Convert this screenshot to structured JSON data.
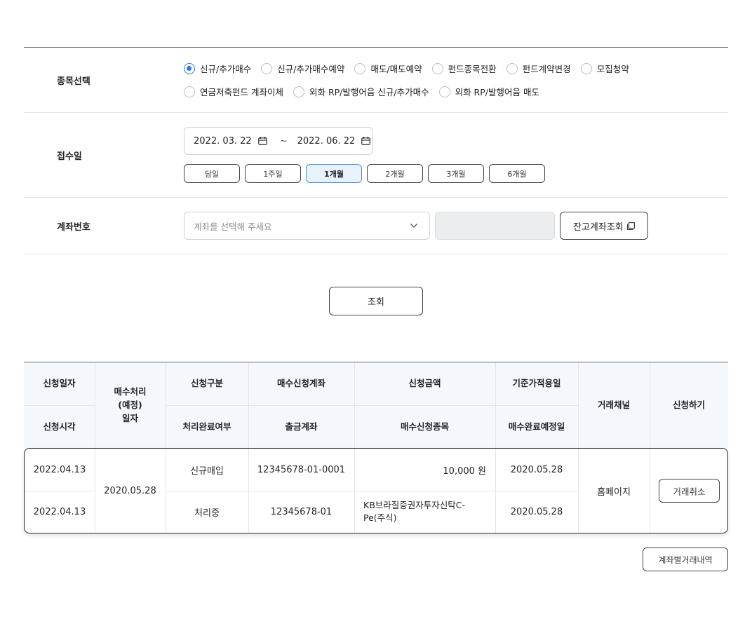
{
  "form": {
    "type_section": {
      "label": "종목선택",
      "options": [
        {
          "label": "신규/추가매수",
          "checked": true
        },
        {
          "label": "신규/추가매수예약",
          "checked": false
        },
        {
          "label": "매도/매도예약",
          "checked": false
        },
        {
          "label": "펀드종목전환",
          "checked": false
        },
        {
          "label": "펀드계약변경",
          "checked": false
        },
        {
          "label": "모집청약",
          "checked": false
        },
        {
          "label": "연금저축펀드 계좌이체",
          "checked": false
        },
        {
          "label": "외화 RP/발행어음 신규/추가매수",
          "checked": false
        },
        {
          "label": "외화 RP/발행어음 매도",
          "checked": false
        }
      ]
    },
    "date_section": {
      "label": "접수일",
      "start_date": "2022. 03. 22",
      "separator": "~",
      "end_date": "2022. 06. 22",
      "periods": [
        "당일",
        "1주일",
        "1개월",
        "2개월",
        "3개월",
        "6개월"
      ],
      "active_period": "1개월"
    },
    "account_section": {
      "label": "계좌번호",
      "select_placeholder": "계좌를 선택해 주세요",
      "balance_button": "잔고계좌조회"
    },
    "search_button": "조회"
  },
  "table": {
    "headers": {
      "apply_date": "신청일자",
      "apply_time": "신청시각",
      "process_date": "매수처리\n(예정)\n일자",
      "apply_type": "신청구분",
      "complete_status": "처리완료여부",
      "buy_account": "매수신청계좌",
      "withdraw_account": "출금계좌",
      "amount": "신청금액",
      "fund_item": "매수신청종목",
      "base_price_date": "기준가적용일",
      "expected_complete_date": "매수완료예정일",
      "channel": "거래채널",
      "action": "신청하기"
    },
    "row": {
      "apply_date": "2022.04.13",
      "apply_time": "2022.04.13",
      "process_date": "2020.05.28",
      "apply_type": "신규매입",
      "complete_status": "처리중",
      "buy_account": "12345678-01-0001",
      "withdraw_account": "12345678-01",
      "amount": "10,000 원",
      "fund_item": "KB브라질증권자투자신탁C-Pe(주식)",
      "base_price_date": "2020.05.28",
      "expected_complete_date": "2020.05.28",
      "channel": "홈페이지",
      "cancel_button": "거래취소"
    }
  },
  "history_button": "계좌별거래내역",
  "colors": {
    "accent": "#2b78e4",
    "active_period_bg": "#e8f2fd",
    "header_bg": "#f4f8fc",
    "readonly_bg": "#ebedef"
  },
  "icons": {
    "calendar": "calendar-icon",
    "chevron": "chevron-down-icon",
    "popup": "new-window-icon"
  }
}
